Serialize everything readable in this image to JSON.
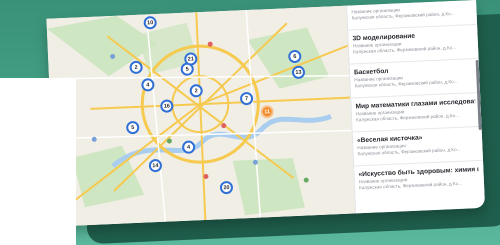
{
  "map": {
    "clusters": [
      {
        "label": "10",
        "variant": "blue"
      },
      {
        "label": "2",
        "variant": "blue"
      },
      {
        "label": "5",
        "variant": "blue"
      },
      {
        "label": "4",
        "variant": "blue"
      },
      {
        "label": "2",
        "variant": "blue"
      },
      {
        "label": "16",
        "variant": "blue"
      },
      {
        "label": "21",
        "variant": "blue"
      },
      {
        "label": "7",
        "variant": "blue"
      },
      {
        "label": "6",
        "variant": "blue"
      },
      {
        "label": "4",
        "variant": "blue"
      },
      {
        "label": "14",
        "variant": "blue"
      },
      {
        "label": "20",
        "variant": "blue"
      },
      {
        "label": "5",
        "variant": "blue"
      },
      {
        "label": "11",
        "variant": "orange"
      },
      {
        "label": "13",
        "variant": "blue"
      }
    ],
    "colors": {
      "road": "#f6c94f",
      "park": "#cfe6c2",
      "water": "#a9cdee",
      "cluster_border": "#2f6fd6",
      "cluster_orange": "#f08a24"
    }
  },
  "sidebar": {
    "items": [
      {
        "title": "Название организации",
        "sub": "Калужская область, Ферзиковский район, д.Ко..."
      },
      {
        "title": "3D моделирование",
        "sub": "Название организации",
        "sub2": "Калужская область, Ферзиковский район, д.Ко..."
      },
      {
        "title": "Баскетбол",
        "sub": "Название организации",
        "sub2": "Калужская область, Ферзиковский район, д.Ко..."
      },
      {
        "title": "Мир математики глазами исследовате...",
        "sub": "Название организации",
        "sub2": "Калужская область, Ферзиковский район, д.Ко..."
      },
      {
        "title": "«Веселая кисточка»",
        "sub": "Название организации",
        "sub2": "Калужская область, Ферзиковский район, д.Ко..."
      },
      {
        "title": "«Искусство быть здоровым: химия в б...",
        "sub": "Название организации",
        "sub2": "Калужская область, Ферзиковский район, д.Ко..."
      }
    ]
  }
}
